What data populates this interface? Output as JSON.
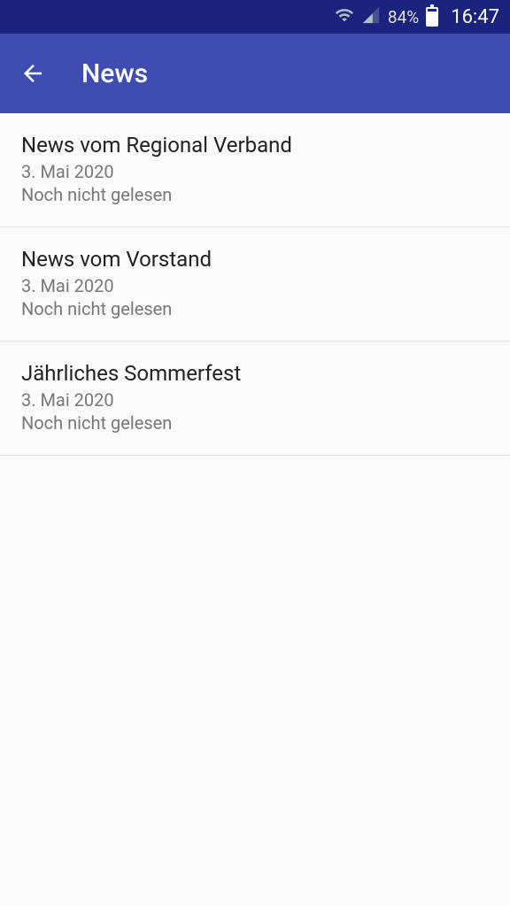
{
  "statusBar": {
    "batteryPercent": "84%",
    "time": "16:47"
  },
  "appBar": {
    "title": "News"
  },
  "news": [
    {
      "title": "News vom Regional Verband",
      "date": "3. Mai 2020",
      "status": "Noch nicht gelesen"
    },
    {
      "title": "News vom Vorstand",
      "date": "3. Mai 2020",
      "status": "Noch nicht gelesen"
    },
    {
      "title": "Jährliches Sommerfest",
      "date": "3. Mai 2020",
      "status": "Noch nicht gelesen"
    }
  ]
}
